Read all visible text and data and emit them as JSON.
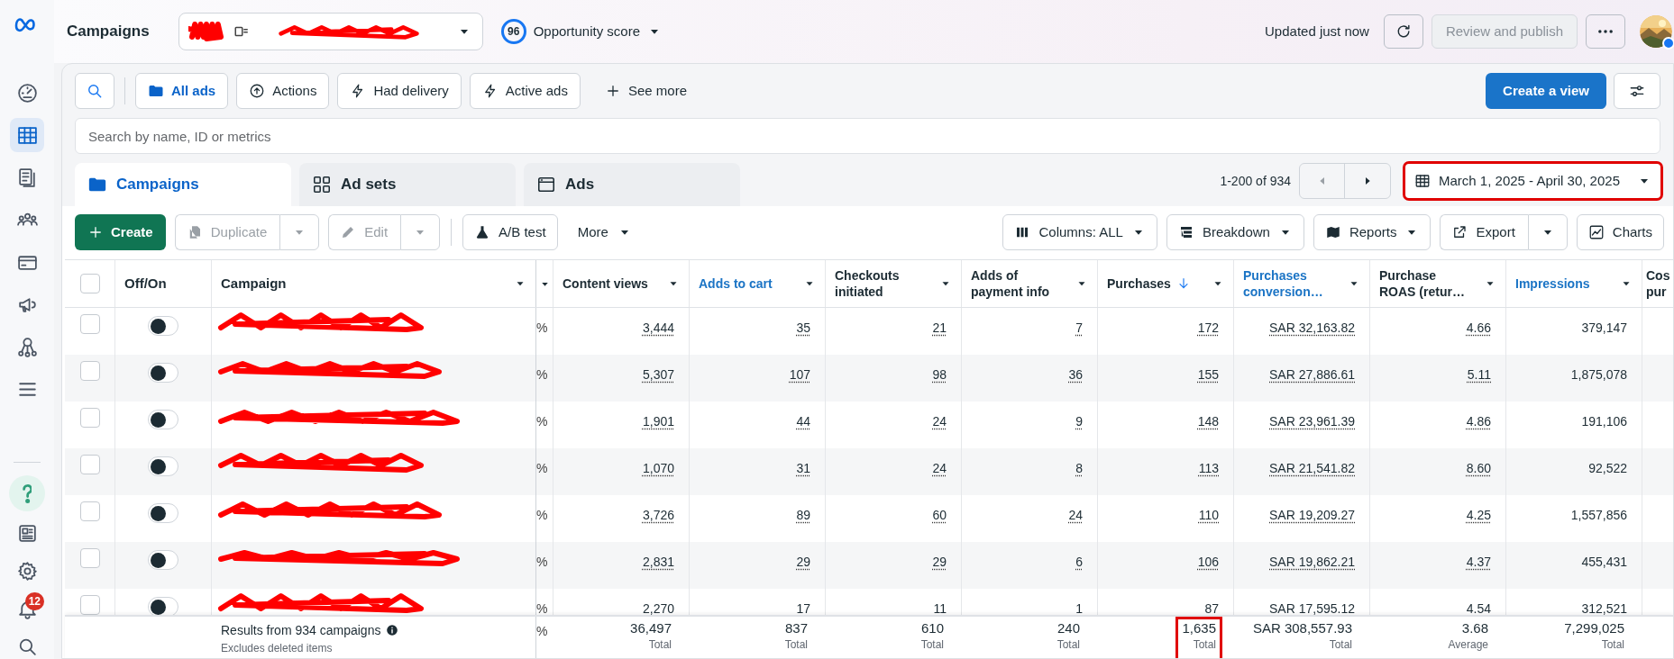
{
  "sidebar": {
    "items": [
      {
        "kind": "gauge",
        "selected": false
      },
      {
        "kind": "table",
        "selected": true
      },
      {
        "kind": "pages",
        "selected": false
      },
      {
        "kind": "people",
        "selected": false
      },
      {
        "kind": "card",
        "selected": false
      },
      {
        "kind": "megaphone",
        "selected": false
      },
      {
        "kind": "network",
        "selected": false
      },
      {
        "kind": "menu",
        "selected": false
      }
    ],
    "bottom_items": [
      {
        "kind": "help",
        "selected": false
      },
      {
        "kind": "news",
        "selected": false
      },
      {
        "kind": "gear",
        "selected": false
      },
      {
        "kind": "bell",
        "selected": false,
        "badge": "12"
      },
      {
        "kind": "search",
        "selected": false
      }
    ]
  },
  "topbar": {
    "title": "Campaigns",
    "account": {
      "redacted": true
    },
    "opportunity": {
      "score": "96",
      "label": "Opportunity score"
    },
    "updated": "Updated just now",
    "review_button": {
      "label": "Review and publish",
      "disabled": true
    }
  },
  "filters": [
    {
      "kind": "chip",
      "label": "All ads",
      "selected": true
    },
    {
      "kind": "chip",
      "label": "Actions",
      "selected": false
    },
    {
      "kind": "chip",
      "label": "Had delivery",
      "selected": false
    },
    {
      "kind": "chip",
      "label": "Active ads",
      "selected": false
    },
    {
      "kind": "link",
      "label": "See more",
      "selected": false
    }
  ],
  "create_view": "Create a view",
  "search": {
    "placeholder": "Search by name, ID or metrics"
  },
  "tabs": [
    {
      "label": "Campaigns",
      "selected": true
    },
    {
      "label": "Ad sets",
      "selected": false
    },
    {
      "label": "Ads",
      "selected": false
    }
  ],
  "pager": "1-200 of 934",
  "date_range": {
    "label": "March 1, 2025 - April 30, 2025",
    "highlighted": true
  },
  "actions_left": [
    {
      "kind": "primary",
      "label": "Create",
      "disabled": false
    },
    {
      "kind": "split",
      "label": "Duplicate",
      "disabled": true
    },
    {
      "kind": "split",
      "label": "Edit",
      "disabled": true
    },
    {
      "kind": "button",
      "label": "A/B test",
      "disabled": false
    },
    {
      "kind": "menu",
      "label": "More",
      "disabled": false
    }
  ],
  "actions_right": [
    {
      "kind": "dropdown",
      "label": "Columns: ALL",
      "disabled": false
    },
    {
      "kind": "dropdown",
      "label": "Breakdown",
      "disabled": false
    },
    {
      "kind": "dropdown",
      "label": "Reports",
      "disabled": false
    },
    {
      "kind": "split",
      "label": "Export",
      "disabled": false
    },
    {
      "kind": "button",
      "label": "Charts",
      "disabled": false
    }
  ],
  "table": {
    "select_all": {
      "checked": false
    },
    "toggle_header": "Off/On",
    "name_header": "Campaign",
    "columns": [
      {
        "label": "Content views",
        "highlighted": false,
        "sorted": false,
        "linked": true
      },
      {
        "label": "Adds to cart",
        "highlighted": true,
        "sorted": false,
        "linked": true
      },
      {
        "label": "Checkouts initiated",
        "highlighted": false,
        "sorted": false,
        "linked": true
      },
      {
        "label": "Adds of payment info",
        "highlighted": false,
        "sorted": false,
        "linked": true
      },
      {
        "label": "Purchases",
        "highlighted": false,
        "sorted": true,
        "linked": true
      },
      {
        "label": "Purchases conversion…",
        "highlighted": true,
        "sorted": false,
        "linked": true
      },
      {
        "label": "Purchase ROAS (retur…",
        "highlighted": false,
        "sorted": false,
        "linked": true
      },
      {
        "label": "Impressions",
        "highlighted": true,
        "sorted": false,
        "linked": false
      }
    ],
    "cut_column": {
      "label_lines": [
        "Cos",
        "pur"
      ]
    },
    "rows": [
      {
        "checked": false,
        "on": false,
        "redacted": true,
        "column_4": "%",
        "values": [
          "3,444",
          "35",
          "21",
          "7",
          "172",
          "SAR 32,163.82",
          "4.66",
          "379,147"
        ]
      },
      {
        "checked": false,
        "on": false,
        "redacted": true,
        "column_4": "%",
        "values": [
          "5,307",
          "107",
          "98",
          "36",
          "155",
          "SAR 27,886.61",
          "5.11",
          "1,875,078"
        ]
      },
      {
        "checked": false,
        "on": false,
        "redacted": true,
        "column_4": "%",
        "values": [
          "1,901",
          "44",
          "24",
          "9",
          "148",
          "SAR 23,961.39",
          "4.86",
          "191,106"
        ]
      },
      {
        "checked": false,
        "on": false,
        "redacted": true,
        "column_4": "%",
        "values": [
          "1,070",
          "31",
          "24",
          "8",
          "113",
          "SAR 21,541.82",
          "8.60",
          "92,522"
        ]
      },
      {
        "checked": false,
        "on": false,
        "redacted": true,
        "column_4": "%",
        "values": [
          "3,726",
          "89",
          "60",
          "24",
          "110",
          "SAR 19,209.27",
          "4.25",
          "1,557,856"
        ]
      },
      {
        "checked": false,
        "on": false,
        "redacted": true,
        "column_4": "%",
        "values": [
          "2,831",
          "29",
          "29",
          "6",
          "106",
          "SAR 19,862.21",
          "4.37",
          "455,431"
        ]
      },
      {
        "checked": false,
        "on": false,
        "redacted": true,
        "column_4": "%",
        "values": [
          "2,270",
          "17",
          "11",
          "1",
          "87",
          "SAR 17,595.12",
          "4.54",
          "312,521"
        ]
      }
    ],
    "footer": {
      "label": "Results from 934 campaigns",
      "sublabel": "Excludes deleted items",
      "column_4": "%",
      "totals": [
        {
          "value": "36,497",
          "label": "Total",
          "highlighted": false
        },
        {
          "value": "837",
          "label": "Total",
          "highlighted": false
        },
        {
          "value": "610",
          "label": "Total",
          "highlighted": false
        },
        {
          "value": "240",
          "label": "Total",
          "highlighted": false
        },
        {
          "value": "1,635",
          "label": "Total",
          "highlighted": true
        },
        {
          "value": "SAR 308,557.93",
          "label": "Total",
          "highlighted": false
        },
        {
          "value": "3.68",
          "label": "Average",
          "highlighted": false
        },
        {
          "value": "7,299,025",
          "label": "Total",
          "highlighted": false
        }
      ]
    }
  }
}
